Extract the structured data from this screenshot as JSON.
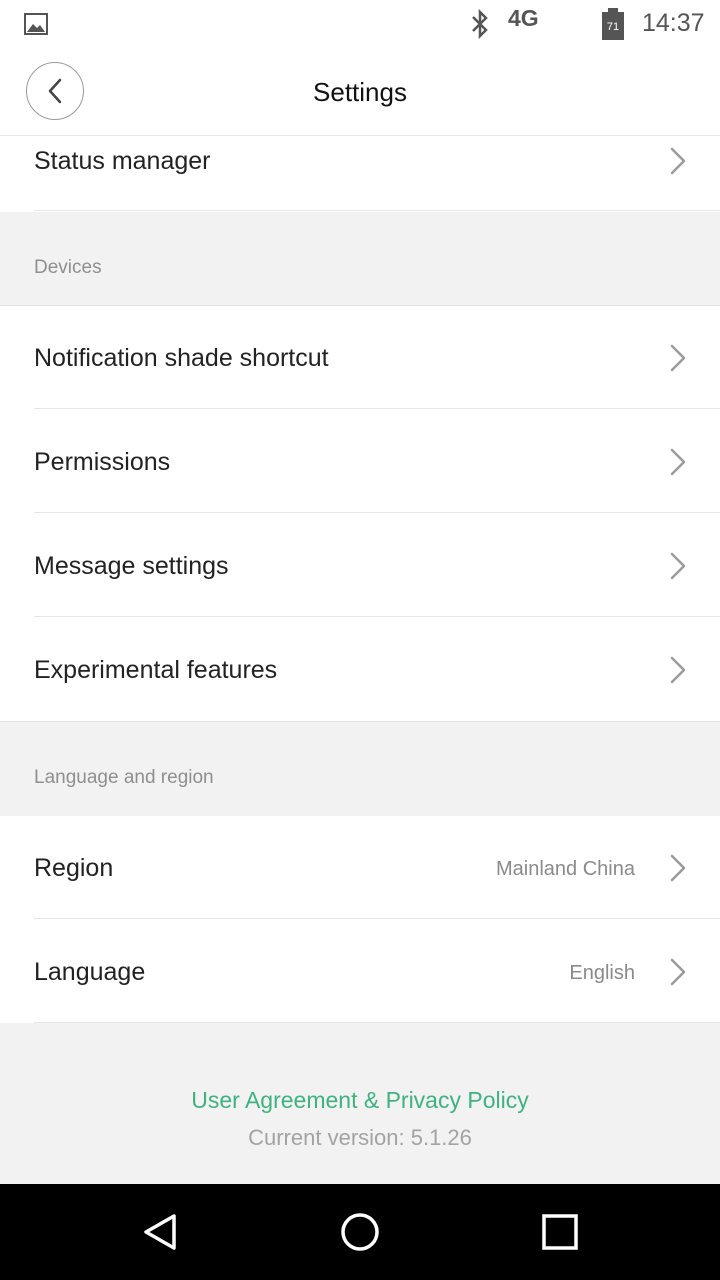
{
  "status_bar": {
    "network": "4G",
    "battery_level": "71",
    "time": "14:37",
    "icons": [
      "image-icon",
      "bluetooth-icon",
      "battery-icon"
    ]
  },
  "header": {
    "title": "Settings",
    "back_icon": "chevron-left-icon"
  },
  "rows_top": [
    {
      "label": "Status manager"
    }
  ],
  "sections": {
    "devices": {
      "title": "Devices",
      "items": [
        {
          "label": "Notification shade shortcut"
        },
        {
          "label": "Permissions"
        },
        {
          "label": "Message settings"
        },
        {
          "label": "Experimental features"
        }
      ]
    },
    "language_region": {
      "title": "Language and region",
      "items": [
        {
          "label": "Region",
          "value": "Mainland China"
        },
        {
          "label": "Language",
          "value": "English"
        }
      ]
    }
  },
  "footer": {
    "link": "User Agreement & Privacy Policy",
    "version": "Current version: 5.1.26"
  },
  "colors": {
    "accent_link": "#3fb27f",
    "background": "#f2f2f2",
    "nav_bar": "#000000"
  },
  "nav_bar": {
    "icons": [
      "back-triangle-icon",
      "home-circle-icon",
      "recents-square-icon"
    ]
  }
}
